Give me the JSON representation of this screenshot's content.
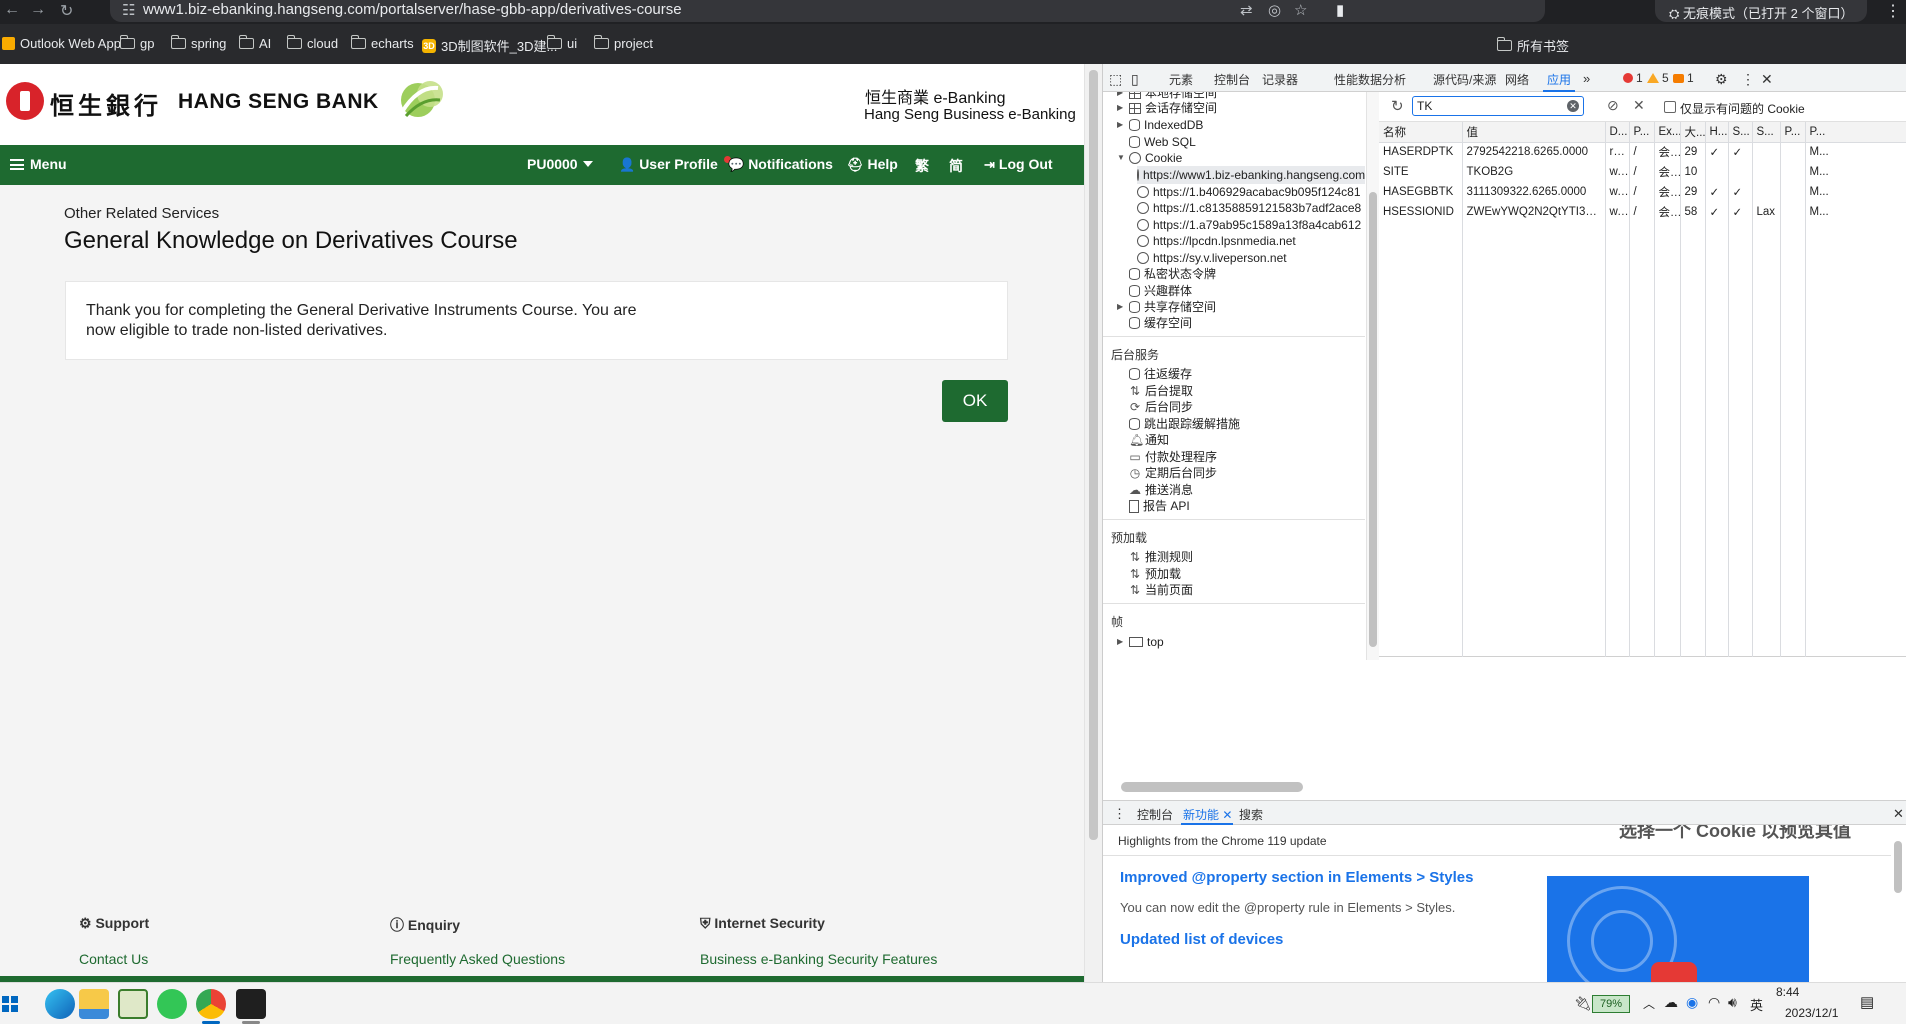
{
  "browser": {
    "url": "www1.biz-ebanking.hangseng.com/portalserver/hase-gbb-app/derivatives-course",
    "incognito_label": "无痕模式（已打开 2 个窗口）",
    "bookmarks": [
      "Outlook Web App",
      "gp",
      "spring",
      "AI",
      "cloud",
      "echarts",
      "3D制图软件_3D建...",
      "ui",
      "project"
    ],
    "all_bookmarks": "所有书签"
  },
  "header": {
    "bank_chinese": "恒生銀行",
    "bank_english": "HANG SENG BANK",
    "ebanking_chinese": "恒生商業 e-Banking",
    "ebanking_english": "Hang Seng Business e-Banking"
  },
  "nav": {
    "menu": "Menu",
    "account": "PU0000",
    "user_profile": "User Profile",
    "notifications": "Notifications",
    "help": "Help",
    "lang_trad": "繁",
    "lang_simp": "简",
    "logout": "Log Out"
  },
  "main": {
    "subtitle": "Other Related Services",
    "title": "General Knowledge on Derivatives Course",
    "message": "Thank you for completing the General Derivative Instruments Course. You are now eligible to trade non-listed derivatives.",
    "ok_button": "OK"
  },
  "footer": {
    "sections": [
      {
        "heading": "Support",
        "link": "Contact Us"
      },
      {
        "heading": "Enquiry",
        "link": "Frequently Asked Questions"
      },
      {
        "heading": "Internet Security",
        "link": "Business e-Banking Security Features"
      }
    ]
  },
  "devtools": {
    "tabs": [
      "元素",
      "控制台",
      "记录器",
      "性能数据分析",
      "源代码/来源",
      "网络",
      "应用"
    ],
    "active_tab": "应用",
    "badges": {
      "errors": "1",
      "warnings": "5",
      "info": "1"
    },
    "tree": {
      "storage": [
        {
          "label": "本地存储空间",
          "icon": "grid-icon"
        },
        {
          "label": "会话存储空间",
          "icon": "grid-icon"
        },
        {
          "label": "IndexedDB",
          "icon": "database-icon"
        },
        {
          "label": "Web SQL",
          "icon": "database-icon"
        },
        {
          "label": "Cookie",
          "icon": "cookie-icon"
        }
      ],
      "cookie_origins": [
        "https://www1.biz-ebanking.hangseng.com",
        "https://1.b406929acabac9b095f124c81",
        "https://1.c81358859121583b7adf2ace8",
        "https://1.a79ab95c1589a13f8a4cab612",
        "https://lpcdn.lpsnmedia.net",
        "https://sy.v.liveperson.net"
      ],
      "storage_more": [
        {
          "label": "私密状态令牌",
          "icon": "database-icon"
        },
        {
          "label": "兴趣群体",
          "icon": "database-icon"
        },
        {
          "label": "共享存储空间",
          "icon": "database-icon"
        },
        {
          "label": "缓存空间",
          "icon": "database-icon"
        }
      ],
      "background_heading": "后台服务",
      "background": [
        {
          "label": "往返缓存",
          "icon": "database-icon"
        },
        {
          "label": "后台提取",
          "icon": "arrows-icon"
        },
        {
          "label": "后台同步",
          "icon": "sync-icon"
        },
        {
          "label": "跳出跟踪缓解措施",
          "icon": "database-icon"
        },
        {
          "label": "通知",
          "icon": "bell-icon"
        },
        {
          "label": "付款处理程序",
          "icon": "card-icon"
        },
        {
          "label": "定期后台同步",
          "icon": "clock-icon"
        },
        {
          "label": "推送消息",
          "icon": "cloud-icon"
        },
        {
          "label": "报告 API",
          "icon": "document-icon"
        }
      ],
      "preload_heading": "预加载",
      "preload": [
        {
          "label": "推测规则",
          "icon": "arrows-icon"
        },
        {
          "label": "预加载",
          "icon": "arrows-icon"
        },
        {
          "label": "当前页面",
          "icon": "arrows-icon"
        }
      ],
      "frames_heading": "帧",
      "frame_top": "top"
    },
    "cookies": {
      "filter_value": "TK",
      "only_issues_label": "仅显示有问题的 Cookie",
      "columns": [
        "名称",
        "值",
        "D...",
        "P...",
        "Ex...",
        "大...",
        "H...",
        "S...",
        "S...",
        "P...",
        "P..."
      ],
      "rows": [
        [
          "HASERDPTK",
          "2792542218.6265.0000",
          "rd...",
          "/",
          "会...",
          "29",
          "✓",
          "✓",
          "",
          "",
          "M..."
        ],
        [
          "SITE",
          "TKOB2G",
          "w...",
          "/",
          "会...",
          "10",
          "",
          "",
          "",
          "",
          "M..."
        ],
        [
          "HASEGBBTK",
          "3111309322.6265.0000",
          "w...",
          "/",
          "会...",
          "29",
          "✓",
          "✓",
          "",
          "",
          "M..."
        ],
        [
          "HSESSIONID",
          "ZWEwYWQ2N2QtYTI3Y...",
          "w...",
          "/",
          "会...",
          "58",
          "✓",
          "✓",
          "Lax",
          "",
          "M..."
        ]
      ],
      "preview_message": "选择一个 Cookie 以预览其值"
    },
    "drawer": {
      "tabs": [
        "控制台",
        "新功能",
        "搜索"
      ],
      "active_tab": "新功能",
      "highlights": "Highlights from the Chrome 119 update",
      "item1_title": "Improved @property section in Elements > Styles",
      "item1_desc": "You can now edit the @property rule in Elements > Styles.",
      "item2_title": "Updated list of devices"
    }
  },
  "taskbar": {
    "battery": "79%",
    "ime": "英",
    "time": "8:44",
    "date": "2023/12/1"
  },
  "colors": {
    "hang_seng_green": "#1e6a30",
    "hang_seng_red": "#d8232a",
    "devtools_blue": "#1a73e8"
  }
}
